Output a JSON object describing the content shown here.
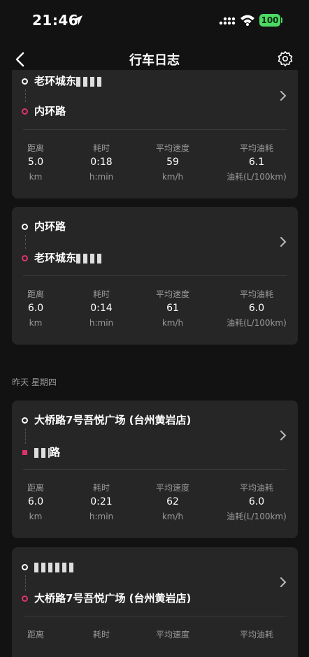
{
  "status": {
    "time": "21:46",
    "battery": "100"
  },
  "nav": {
    "title": "行车日志"
  },
  "trips": [
    {
      "start": "老环城东",
      "end": "内环路",
      "stats": [
        {
          "label": "距离",
          "value": "5.0",
          "unit": "km"
        },
        {
          "label": "耗时",
          "value": "0:18",
          "unit": "h:min"
        },
        {
          "label": "平均速度",
          "value": "59",
          "unit": "km/h"
        },
        {
          "label": "平均油耗",
          "value": "6.1",
          "unit": "油耗(L/100km)"
        }
      ]
    },
    {
      "start": "内环路",
      "end": "老环城东",
      "stats": [
        {
          "label": "距离",
          "value": "6.0",
          "unit": "km"
        },
        {
          "label": "耗时",
          "value": "0:14",
          "unit": "h:min"
        },
        {
          "label": "平均速度",
          "value": "61",
          "unit": "km/h"
        },
        {
          "label": "平均油耗",
          "value": "6.0",
          "unit": "油耗(L/100km)"
        }
      ]
    },
    {
      "start": "大桥路7号吾悦广场 (台州黄岩店)",
      "end": "路",
      "stats": [
        {
          "label": "距离",
          "value": "6.0",
          "unit": "km"
        },
        {
          "label": "耗时",
          "value": "0:21",
          "unit": "h:min"
        },
        {
          "label": "平均速度",
          "value": "62",
          "unit": "km/h"
        },
        {
          "label": "平均油耗",
          "value": "6.0",
          "unit": "油耗(L/100km)"
        }
      ]
    },
    {
      "start": "",
      "end": "大桥路7号吾悦广场 (台州黄岩店)",
      "stats": [
        {
          "label": "距离",
          "value": "",
          "unit": ""
        },
        {
          "label": "耗时",
          "value": "",
          "unit": ""
        },
        {
          "label": "平均速度",
          "value": "",
          "unit": ""
        },
        {
          "label": "平均油耗",
          "value": "",
          "unit": ""
        }
      ]
    }
  ],
  "section": {
    "yesterday": "昨天 星期四"
  }
}
